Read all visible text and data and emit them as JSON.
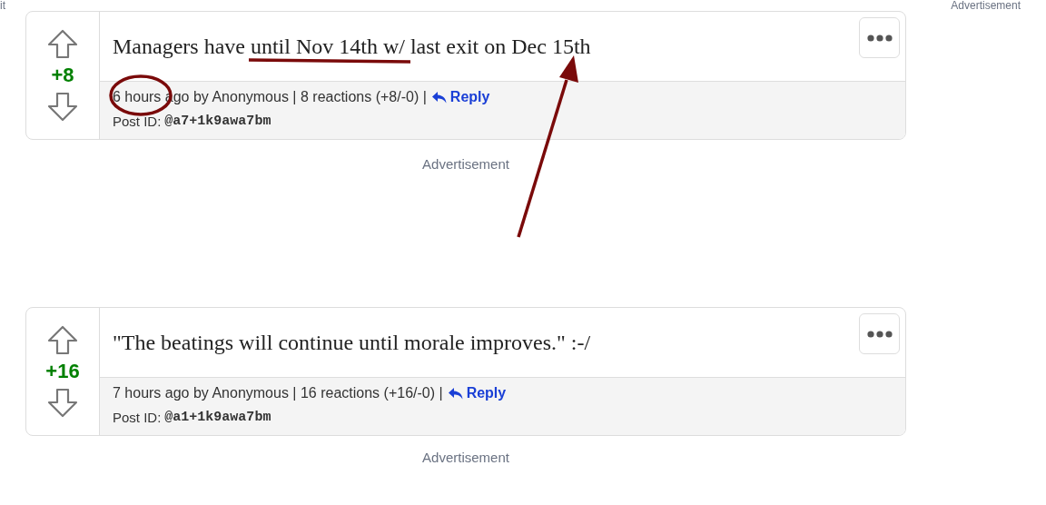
{
  "top_labels": [
    {
      "text": "it",
      "kind": "left"
    },
    {
      "text": "Advertisement",
      "kind": "right"
    }
  ],
  "posts": [
    {
      "score": "+8",
      "title": "Managers have until Nov 14th w/ last exit on Dec 15th",
      "meta": "6 hours ago by Anonymous | 8 reactions (+8/-0) |",
      "reply": "Reply",
      "post_id_label": "Post ID:",
      "post_id": "@a7+1k9awa7bm",
      "ad": "Advertisement"
    },
    {
      "score": "+16",
      "title": "\"The beatings will continue until morale improves.\" :-/",
      "meta": "7 hours ago by Anonymous | 16 reactions (+16/-0) |",
      "reply": "Reply",
      "post_id_label": "Post ID:",
      "post_id": "@a1+1k9awa7bm",
      "ad": "Advertisement"
    }
  ],
  "annotations": [
    {
      "kind": "underline"
    },
    {
      "kind": "circle"
    },
    {
      "kind": "arrow"
    }
  ]
}
